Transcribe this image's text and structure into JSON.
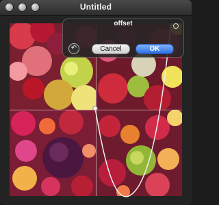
{
  "window": {
    "title": "Untitled"
  },
  "hud": {
    "title": "offset",
    "reset_glyph": "↶",
    "cancel_label": "Cancel",
    "ok_label": "OK"
  },
  "colors": {
    "accent_ok": "#2d6fe0",
    "background": "#232323"
  }
}
